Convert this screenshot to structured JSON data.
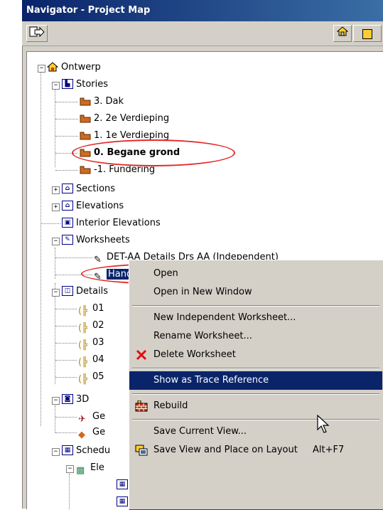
{
  "window": {
    "title": "Navigator - Project Map"
  },
  "tree": {
    "root": "Ontwerp",
    "stories_label": "Stories",
    "stories": [
      "3. Dak",
      "2. 2e Verdieping",
      "1. 1e Verdieping",
      "0. Begane grond",
      "-1. Fundering"
    ],
    "sections": "Sections",
    "elevations": "Elevations",
    "interior_elevations": "Interior Elevations",
    "worksheets_label": "Worksheets",
    "worksheets": [
      "DET-AA Details Drs AA (Independent)",
      "Handschets (Independent)"
    ],
    "details_label": "Details",
    "details": [
      "01",
      "02",
      "03",
      "04",
      "05"
    ],
    "threed_label": "3D",
    "threed": [
      "Ge",
      "Ge"
    ],
    "schedules_label": "Schedu",
    "schedule_sub": "Ele"
  },
  "context_menu": {
    "items": [
      {
        "label": "Open",
        "icon": ""
      },
      {
        "label": "Open in New Window",
        "icon": ""
      },
      {
        "label": "New Independent Worksheet...",
        "icon": ""
      },
      {
        "label": "Rename Worksheet...",
        "icon": ""
      },
      {
        "label": "Delete Worksheet",
        "icon": "red-x-icon"
      },
      {
        "label": "Show as Trace Reference",
        "icon": ""
      },
      {
        "label": "Rebuild",
        "icon": "brick-wall-icon"
      },
      {
        "label": "Save Current View...",
        "icon": ""
      },
      {
        "label": "Save View and Place on Layout",
        "icon": "layout-place-icon",
        "shortcut": "Alt+F7"
      }
    ],
    "highlighted": "Show as Trace Reference"
  },
  "colors": {
    "selection": "#0a246a",
    "annotation_ellipse": "#e22b2b",
    "story_icon": "#d2691e"
  }
}
